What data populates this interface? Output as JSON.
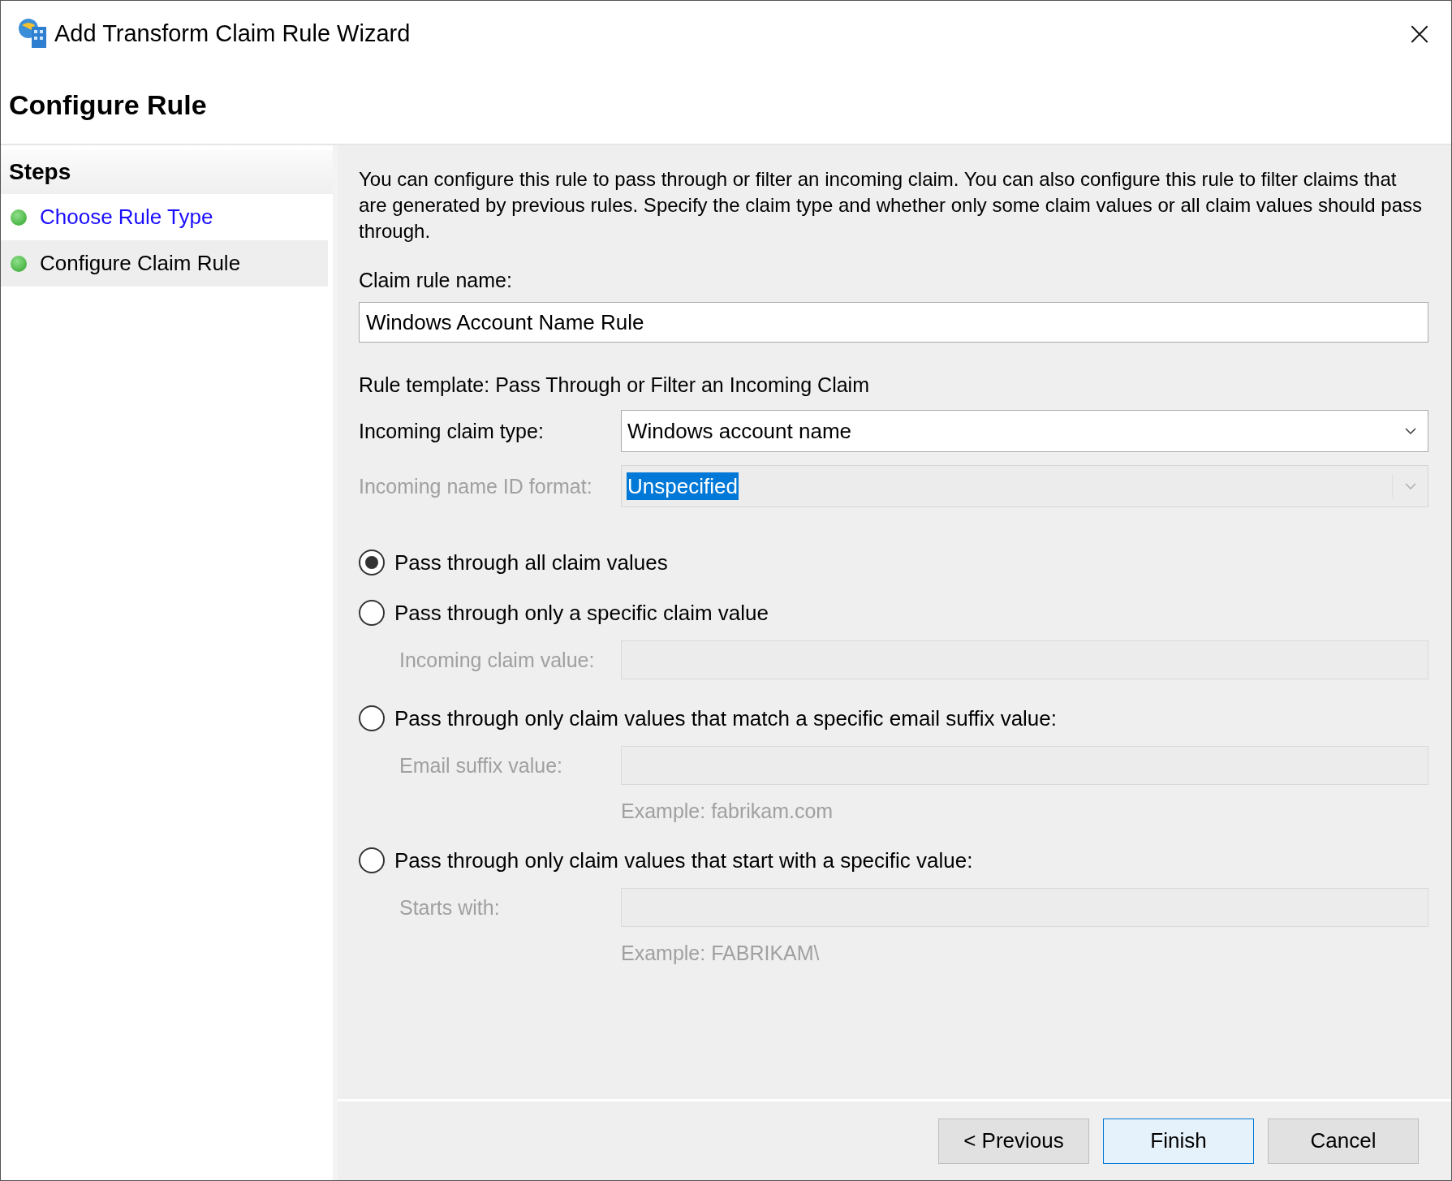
{
  "window": {
    "title": "Add Transform Claim Rule Wizard",
    "close": "×"
  },
  "page_title": "Configure Rule",
  "steps": {
    "heading": "Steps",
    "items": [
      {
        "label": "Choose Rule Type",
        "selected": false
      },
      {
        "label": "Configure Claim Rule",
        "selected": true
      }
    ]
  },
  "description": "You can configure this rule to pass through or filter an incoming claim. You can also configure this rule to filter claims that are generated by previous rules. Specify the claim type and whether only some claim values or all claim values should pass through.",
  "claim_rule_name": {
    "label": "Claim rule name:",
    "value": "Windows Account Name Rule"
  },
  "rule_template": "Rule template: Pass Through or Filter an Incoming Claim",
  "dropdowns": [
    {
      "label": "Incoming claim type:",
      "value": "Windows account name",
      "disabled": false,
      "highlighted": false
    },
    {
      "label": "Incoming name ID format:",
      "value": "Unspecified",
      "disabled": true,
      "highlighted": true
    }
  ],
  "options": [
    {
      "label": "Pass through all claim values",
      "selected": true
    },
    {
      "label": "Pass through only a specific claim value",
      "selected": false,
      "field": {
        "label": "Incoming claim value:",
        "disabled": true
      }
    },
    {
      "label": "Pass through only claim values that match a specific email suffix value:",
      "selected": false,
      "field": {
        "label": "Email suffix value:",
        "disabled": true,
        "example": "Example: fabrikam.com"
      }
    },
    {
      "label": "Pass through only claim values that start with a specific value:",
      "selected": false,
      "field": {
        "label": "Starts with:",
        "disabled": true,
        "example": "Example: FABRIKAM\\"
      }
    }
  ],
  "buttons": [
    {
      "label": "< Previous",
      "selected": false
    },
    {
      "label": "Finish",
      "selected": true
    },
    {
      "label": "Cancel",
      "selected": false
    }
  ]
}
